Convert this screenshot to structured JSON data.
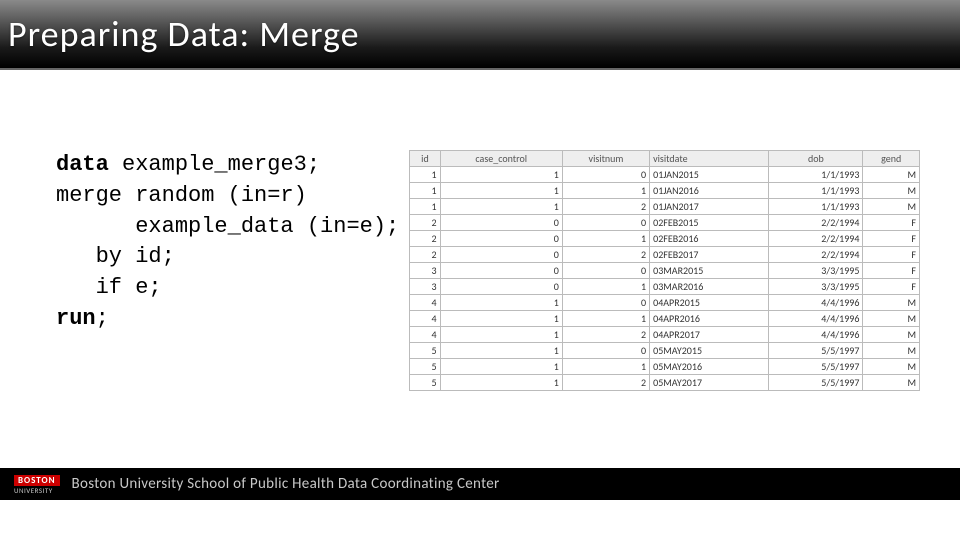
{
  "title": "Preparing Data: Merge",
  "code": {
    "l1_kw": "data",
    "l1_rest": " example_merge3;",
    "l2": "merge random (in=r)",
    "l3": "      example_data (in=e);",
    "l4": "   by id;",
    "l5": "   if e;",
    "l6_kw": "run",
    "l6_rest": ";"
  },
  "table": {
    "headers": [
      "id",
      "case_control",
      "visitnum",
      "visitdate",
      "dob",
      "gend"
    ],
    "rows": [
      [
        "1",
        "1",
        "0",
        "01JAN2015",
        "1/1/1993",
        "M"
      ],
      [
        "1",
        "1",
        "1",
        "01JAN2016",
        "1/1/1993",
        "M"
      ],
      [
        "1",
        "1",
        "2",
        "01JAN2017",
        "1/1/1993",
        "M"
      ],
      [
        "2",
        "0",
        "0",
        "02FEB2015",
        "2/2/1994",
        "F"
      ],
      [
        "2",
        "0",
        "1",
        "02FEB2016",
        "2/2/1994",
        "F"
      ],
      [
        "2",
        "0",
        "2",
        "02FEB2017",
        "2/2/1994",
        "F"
      ],
      [
        "3",
        "0",
        "0",
        "03MAR2015",
        "3/3/1995",
        "F"
      ],
      [
        "3",
        "0",
        "1",
        "03MAR2016",
        "3/3/1995",
        "F"
      ],
      [
        "4",
        "1",
        "0",
        "04APR2015",
        "4/4/1996",
        "M"
      ],
      [
        "4",
        "1",
        "1",
        "04APR2016",
        "4/4/1996",
        "M"
      ],
      [
        "4",
        "1",
        "2",
        "04APR2017",
        "4/4/1996",
        "M"
      ],
      [
        "5",
        "1",
        "0",
        "05MAY2015",
        "5/5/1997",
        "M"
      ],
      [
        "5",
        "1",
        "1",
        "05MAY2016",
        "5/5/1997",
        "M"
      ],
      [
        "5",
        "1",
        "2",
        "05MAY2017",
        "5/5/1997",
        "M"
      ]
    ]
  },
  "footer": {
    "logo_top": "BOSTON",
    "logo_bot": "UNIVERSITY",
    "text": "Boston University School of Public Health Data Coordinating Center"
  }
}
